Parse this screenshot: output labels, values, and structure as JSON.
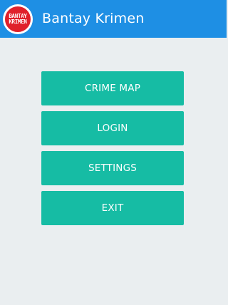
{
  "app_bar": {
    "title": "Bantay Krimen",
    "logo": {
      "line1": "BANTAY",
      "line2": "KRIMEN"
    },
    "background_color": "#1e8fe4"
  },
  "menu": {
    "button_color": "#16bca4",
    "buttons": [
      {
        "label": "CRIME MAP"
      },
      {
        "label": "LOGIN"
      },
      {
        "label": "SETTINGS"
      },
      {
        "label": "EXIT"
      }
    ]
  }
}
